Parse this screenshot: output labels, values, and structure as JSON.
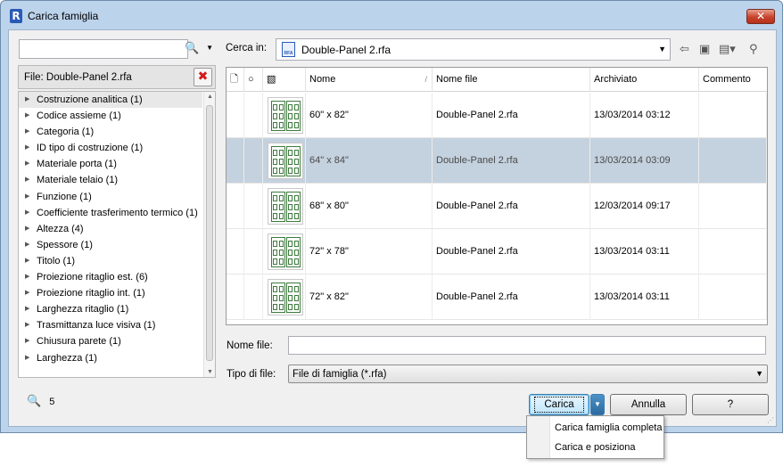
{
  "window": {
    "title": "Carica famiglia",
    "app_icon_letter": "R",
    "close_glyph": "✕"
  },
  "left": {
    "search_placeholder": "",
    "file_label": "File: Double-Panel 2.rfa",
    "remove_glyph": "✖",
    "tree_items": [
      {
        "label": "Costruzione analitica  (1)",
        "selected": true
      },
      {
        "label": "Codice assieme  (1)"
      },
      {
        "label": "Categoria  (1)"
      },
      {
        "label": "ID tipo di costruzione  (1)"
      },
      {
        "label": "Materiale porta  (1)"
      },
      {
        "label": "Materiale telaio  (1)"
      },
      {
        "label": "Funzione  (1)"
      },
      {
        "label": "Coefficiente trasferimento termico  (1)"
      },
      {
        "label": "Altezza  (4)"
      },
      {
        "label": "Spessore  (1)"
      },
      {
        "label": "Titolo  (1)"
      },
      {
        "label": "Proiezione ritaglio est.  (6)"
      },
      {
        "label": "Proiezione ritaglio int.  (1)"
      },
      {
        "label": "Larghezza ritaglio  (1)"
      },
      {
        "label": "Trasmittanza luce visiva  (1)"
      },
      {
        "label": "Chiusura parete  (1)"
      },
      {
        "label": "Larghezza  (1)"
      }
    ],
    "result_count": "5"
  },
  "right": {
    "look_in_label": "Cerca in:",
    "look_in_value": "Double-Panel 2.rfa",
    "columns": {
      "nome": "Nome",
      "nome_file": "Nome file",
      "archiviato": "Archiviato",
      "commento": "Commento"
    },
    "rows": [
      {
        "nome": "60\" x 82\"",
        "file": "Double-Panel 2.rfa",
        "archiviato": "13/03/2014 03:12",
        "commento": ""
      },
      {
        "nome": "64\" x 84\"",
        "file": "Double-Panel 2.rfa",
        "archiviato": "13/03/2014 03:09",
        "commento": "",
        "selected": true
      },
      {
        "nome": "68\" x 80\"",
        "file": "Double-Panel 2.rfa",
        "archiviato": "12/03/2014 09:17",
        "commento": ""
      },
      {
        "nome": "72\" x 78\"",
        "file": "Double-Panel 2.rfa",
        "archiviato": "13/03/2014 03:11",
        "commento": ""
      },
      {
        "nome": "72\" x 82\"",
        "file": "Double-Panel 2.rfa",
        "archiviato": "13/03/2014 03:11",
        "commento": ""
      }
    ],
    "filename_label": "Nome file:",
    "filename_value": "",
    "filetype_label": "Tipo di file:",
    "filetype_value": "File di famiglia (*.rfa)"
  },
  "buttons": {
    "load": "Carica",
    "cancel": "Annulla",
    "help": "?"
  },
  "load_menu": {
    "items": [
      "Carica famiglia completa",
      "Carica e posiziona"
    ]
  },
  "colors": {
    "selected_row": "#c4d1de",
    "window_frame": "#bcd3ec",
    "close_button": "#c7422b"
  }
}
